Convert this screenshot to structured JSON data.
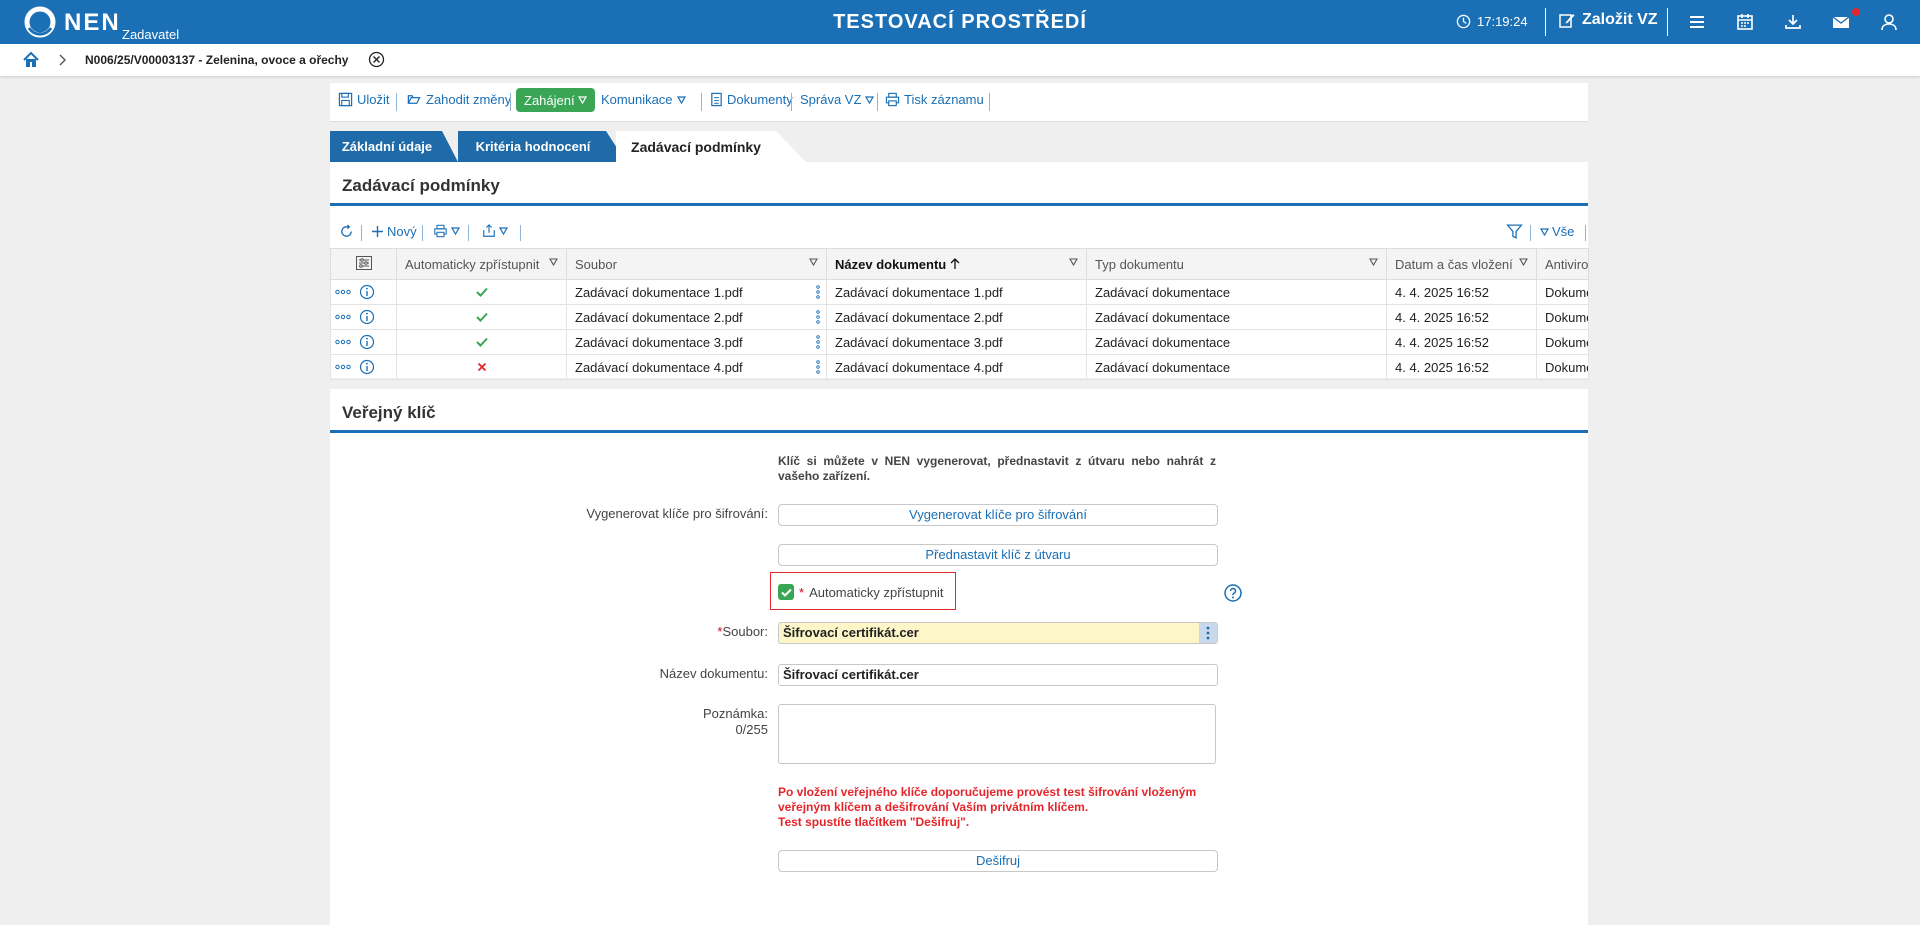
{
  "header": {
    "logo_text": "NEN",
    "logo_sub": "Zadavatel",
    "env_title": "TESTOVACÍ PROSTŘEDÍ",
    "clock": "17:19:24",
    "create_label": "Založit VZ"
  },
  "breadcrumb": {
    "text": "N006/25/V00003137 - Zelenina, ovoce a ořechy"
  },
  "toolbar": {
    "save": "Uložit",
    "discard": "Zahodit změny",
    "start": "Zahájení",
    "communication": "Komunikace",
    "documents": "Dokumenty",
    "manage": "Správa VZ",
    "print": "Tisk záznamu"
  },
  "tabs": [
    "Základní údaje",
    "Kritéria hodnocení",
    "Zadávací podmínky"
  ],
  "section1": {
    "title": "Zadávací podmínky",
    "new_label": "Nový",
    "all_label": "Vše",
    "columns": [
      "Automaticky zpřístupnit",
      "Soubor",
      "Název dokumentu",
      "Typ dokumentu",
      "Datum a čas vložení",
      "Antiviro"
    ],
    "rows": [
      {
        "auto": true,
        "file": "Zadávací dokumentace 1.pdf",
        "name": "Zadávací dokumentace 1.pdf",
        "type": "Zadávací dokumentace",
        "date": "4. 4. 2025 16:52",
        "av": "Dokume"
      },
      {
        "auto": true,
        "file": "Zadávací dokumentace 2.pdf",
        "name": "Zadávací dokumentace 2.pdf",
        "type": "Zadávací dokumentace",
        "date": "4. 4. 2025 16:52",
        "av": "Dokume"
      },
      {
        "auto": true,
        "file": "Zadávací dokumentace 3.pdf",
        "name": "Zadávací dokumentace 3.pdf",
        "type": "Zadávací dokumentace",
        "date": "4. 4. 2025 16:52",
        "av": "Dokume"
      },
      {
        "auto": false,
        "file": "Zadávací dokumentace 4.pdf",
        "name": "Zadávací dokumentace 4.pdf",
        "type": "Zadávací dokumentace",
        "date": "4. 4. 2025 16:52",
        "av": "Dokume"
      }
    ]
  },
  "section2": {
    "title": "Veřejný klíč",
    "info": "Klíč si můžete v NEN vygenerovat, přednastavit z útvaru nebo nahrát z vašeho zařízení.",
    "gen_label": "Vygenerovat klíče pro šifrování:",
    "gen_button": "Vygenerovat klíče pro šifrování",
    "preset_button": "Přednastavit klíč z útvaru",
    "auto_label": "Automaticky zpřístupnit",
    "file_label": "Soubor:",
    "file_value": "Šifrovací certifikát.cer",
    "docname_label": "Název dokumentu:",
    "docname_value": "Šifrovací certifikát.cer",
    "note_label": "Poznámka:",
    "note_count": "0/255",
    "warning_1": "Po vložení veřejného klíče doporučujeme provést test šifrování vloženým veřejným klíčem a dešifrování Vaším privátním klíčem.",
    "warning_2": "Test spustíte tlačítkem \"Dešifruj\".",
    "decrypt_button": "Dešifruj"
  },
  "colors": {
    "primary": "#1a6fb5",
    "success": "#3aa655",
    "danger": "#e3262b",
    "highlight": "#fdf6c8"
  }
}
